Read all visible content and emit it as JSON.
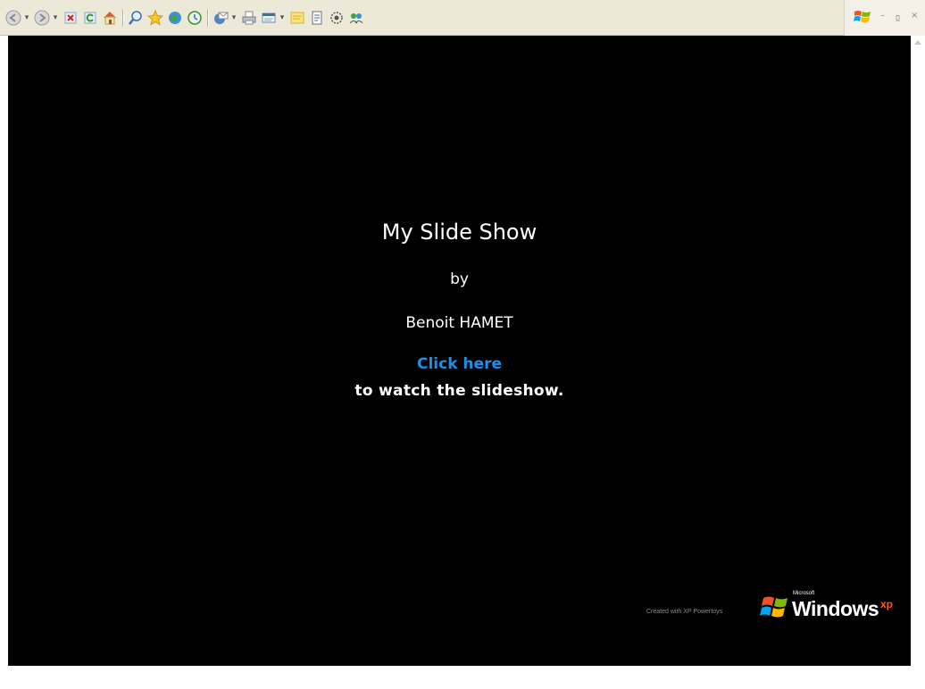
{
  "toolbar": {
    "buttons": [
      {
        "name": "back-button",
        "icon": "back-arrow-icon",
        "dropdown": true
      },
      {
        "name": "forward-button",
        "icon": "forward-arrow-icon",
        "dropdown": true
      },
      {
        "name": "stop-button",
        "icon": "stop-icon",
        "dropdown": false
      },
      {
        "name": "refresh-button",
        "icon": "refresh-icon",
        "dropdown": false
      },
      {
        "name": "home-button",
        "icon": "home-icon",
        "dropdown": false
      },
      {
        "name": "search-button",
        "icon": "search-icon",
        "dropdown": false
      },
      {
        "name": "favorites-button",
        "icon": "star-icon",
        "dropdown": false
      },
      {
        "name": "media-button",
        "icon": "media-globe-icon",
        "dropdown": false
      },
      {
        "name": "history-button",
        "icon": "history-icon",
        "dropdown": false
      },
      {
        "name": "mail-button",
        "icon": "mail-icon",
        "dropdown": true
      },
      {
        "name": "print-button",
        "icon": "print-icon",
        "dropdown": false
      },
      {
        "name": "edit-button",
        "icon": "edit-icon",
        "dropdown": true
      },
      {
        "name": "discuss-button",
        "icon": "notes-icon",
        "dropdown": false
      },
      {
        "name": "research-button",
        "icon": "research-icon",
        "dropdown": false
      },
      {
        "name": "messenger-button",
        "icon": "messenger-icon",
        "dropdown": false
      },
      {
        "name": "people-button",
        "icon": "people-icon",
        "dropdown": false
      }
    ],
    "minimize_glyph": "–",
    "restore_glyph": "ﾛ",
    "close_glyph": "×"
  },
  "slide": {
    "title": "My Slide Show",
    "by": "by",
    "author": "Benoit HAMET",
    "link_label": "Click here",
    "description": "to watch the slideshow."
  },
  "branding": {
    "credit": "Created with XP Powertoys",
    "microsoft": "Microsoft",
    "windows": "Windows",
    "xp": "xp"
  },
  "colors": {
    "background": "#000000",
    "text": "#ffffff",
    "link": "#1e8fe6",
    "toolbar": "#ece9d8",
    "xp_accent": "#ff5a1e"
  }
}
